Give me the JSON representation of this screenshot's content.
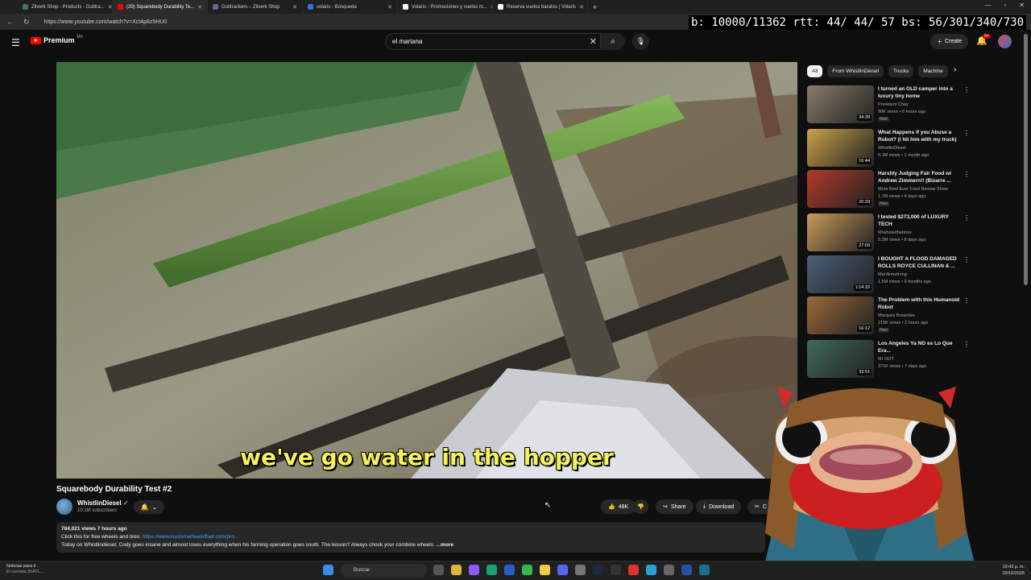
{
  "browser": {
    "tabs": [
      {
        "title": "Zilverk Shop - Products - Gotitra...",
        "favicon_color": "#3b7a57",
        "active": false
      },
      {
        "title": "(20) Squarebody Durability Te...",
        "favicon_color": "#ff0000",
        "active": true
      },
      {
        "title": "Gotitrackers – Zilverk Shop",
        "favicon_color": "#5a6b8c",
        "active": false
      },
      {
        "title": "volaris - Búsqueda",
        "favicon_color": "#2e73d8",
        "active": false
      },
      {
        "title": "Volaris - Promociones y vuelos m...",
        "favicon_color": "#ffffff",
        "active": false
      },
      {
        "title": "Reserva vuelos baratos | Volaris",
        "favicon_color": "#ffffff",
        "active": false
      }
    ],
    "new_tab": "+",
    "url": "https://www.youtube.com/watch?v=Xct4p8z5HU0",
    "stats_overlay": "b: 10000/11362 rtt:  44/ 44/ 57 bs: 56/301/340/730"
  },
  "header": {
    "logo_text": "Premium",
    "logo_region": "MX",
    "search_value": "el mariana",
    "create_label": "Create",
    "notif_badge": "9+"
  },
  "video": {
    "caption": "we've go water in the hopper",
    "title": "Squarebody Durability Test #2",
    "channel": "WhistlinDiesel",
    "subscribers": "10.1M subscribers",
    "likes": "48K",
    "share_label": "Share",
    "download_label": "Download",
    "clip_label": "C",
    "views_line": "784,021 views  7 hours ago",
    "desc_line1": "Click this for free wheels and tires: ",
    "desc_link": "https://www.customwheeloffset.com/pro...",
    "desc_line2": "Today on Whistlindiesel, Cody goes insane and almost loses everything when his farming operation goes south. The lesson? Always chock your combine wheels.",
    "desc_more": " ...more"
  },
  "sidebar": {
    "chips": [
      "All",
      "From WhistlinDiesel",
      "Trucks",
      "Machine"
    ],
    "recommendations": [
      {
        "title": "I turned an OLD camper into a luxury tiny home",
        "channel": "President Chay",
        "views": "90K views • 6 hours ago",
        "badge": "New",
        "duration": "34:39",
        "thumb": "#8a7d6a"
      },
      {
        "title": "What Happens if you Abuse a Robot? (I hit him with my truck)",
        "channel": "WhistlinDiesel",
        "views": "6.1M views • 1 month ago",
        "badge": "",
        "duration": "16:44",
        "thumb": "#c9a24a"
      },
      {
        "title": "Harshly Judging Fair Food w/ Andrew Zimmern!! (Bizarre ...",
        "channel": "More Best Ever Food Review Show",
        "views": "1.1M views • 4 days ago",
        "badge": "New",
        "duration": "20:29",
        "thumb": "#b23a2a"
      },
      {
        "title": "I tested $273,000 of LUXURY TECH",
        "channel": "Mrwhosetheboss",
        "views": "5.2M views • 8 days ago",
        "badge": "",
        "duration": "27:09",
        "thumb": "#c89a5a"
      },
      {
        "title": "I BOUGHT A FLOOD DAMAGED ROLLS ROYCE CULLINAN & ...",
        "channel": "Mat Armstrong",
        "views": "1.5M views • 9 months ago",
        "badge": "",
        "duration": "1:14:33",
        "thumb": "#4a6078"
      },
      {
        "title": "The Problem with this Humanoid Robot",
        "channel": "Marques Brownlee",
        "views": "215K views • 2 hours ago",
        "badge": "New",
        "duration": "16:12",
        "thumb": "#9a6a3a"
      },
      {
        "title": "Los Angeles Ya NO es Lo Que Era...",
        "channel": "Mr OOT",
        "views": "371K views • 7 days ago",
        "badge": "",
        "duration": "33:51",
        "thumb": "#3f6a5a"
      }
    ]
  },
  "taskbar": {
    "news_title": "Noticias para ti",
    "news_sub": "El cometa 3I/ATL...",
    "search_placeholder": "Buscar",
    "time": "10:43 p. m.",
    "date": "29/10/2025"
  }
}
